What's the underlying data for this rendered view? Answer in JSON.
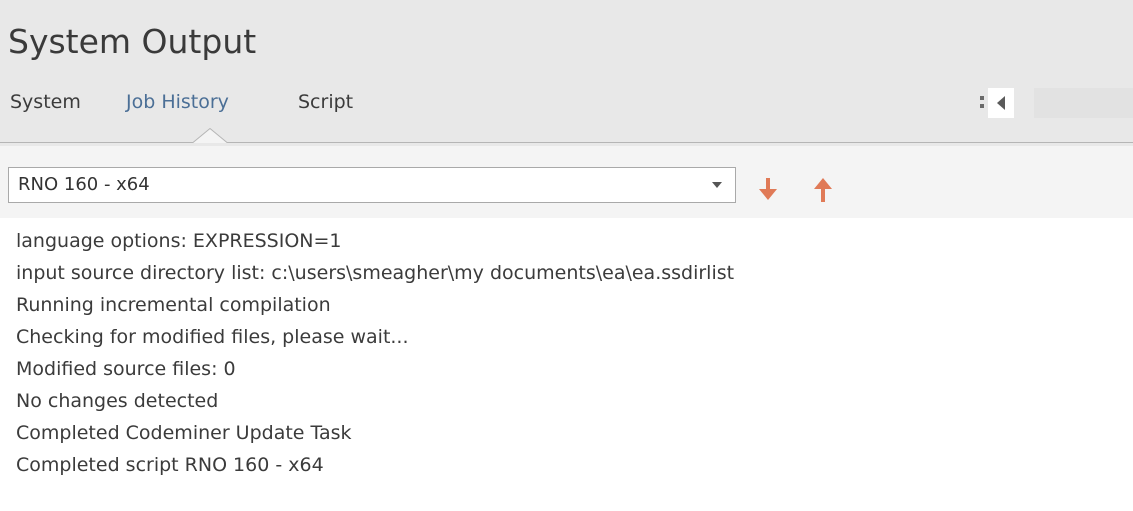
{
  "window": {
    "title": "System Output"
  },
  "tabs": [
    {
      "label": "System",
      "active": false
    },
    {
      "label": "Job History",
      "active": true
    },
    {
      "label": "Script",
      "active": false
    }
  ],
  "toolbar": {
    "job_select_value": "RNO 160 - x64",
    "down_icon": "arrow-down-icon",
    "up_icon": "arrow-up-icon"
  },
  "colors": {
    "header_bg": "#e8e8e8",
    "active_tab": "#4b6f96",
    "arrow_accent": "#e07a57"
  },
  "output_lines": [
    "language options: EXPRESSION=1",
    "input source directory list: c:\\users\\smeagher\\my documents\\ea\\ea.ssdirlist",
    "Running incremental compilation",
    "Checking for modified files, please wait...",
    "Modified source files: 0",
    "No changes detected",
    "Completed Codeminer Update Task",
    "Completed script RNO 160 - x64"
  ]
}
